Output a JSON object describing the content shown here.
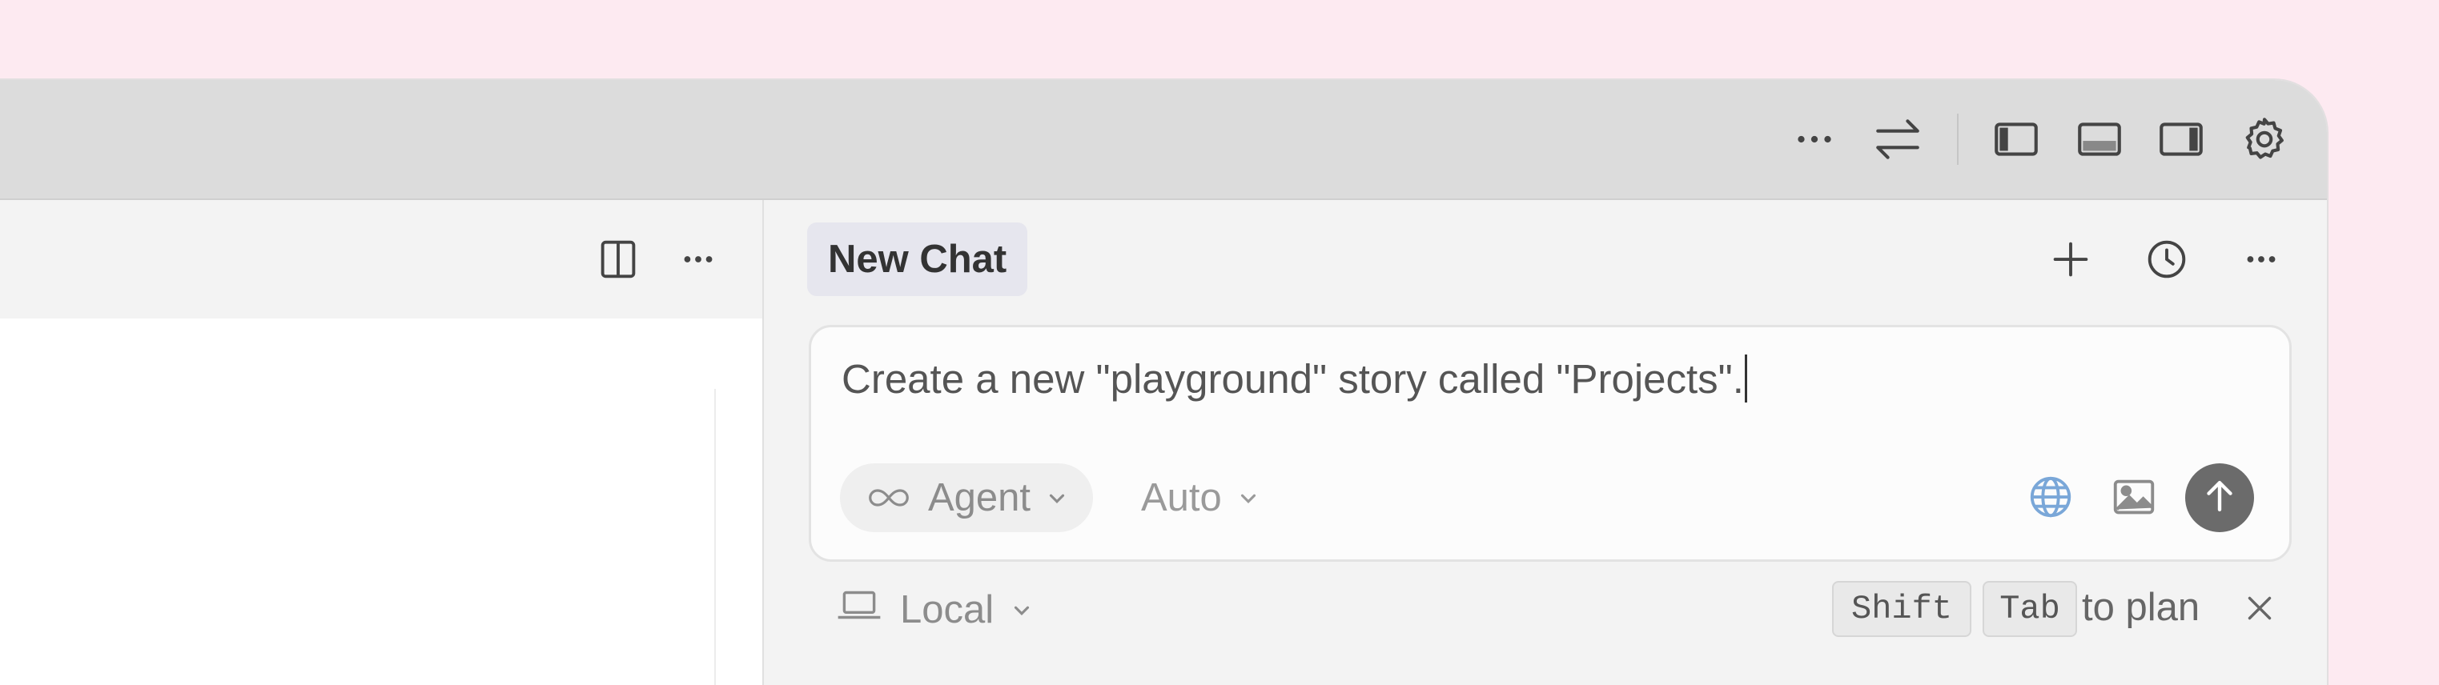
{
  "titlebar": {
    "icons": [
      "more-icon",
      "swap-arrows-icon",
      "toggle-left-panel-icon",
      "toggle-bottom-panel-icon",
      "toggle-right-panel-icon",
      "settings-gear-icon"
    ]
  },
  "editor": {
    "icons": [
      "split-editor-icon",
      "more-icon"
    ]
  },
  "chat": {
    "tab_label": "New Chat",
    "header_icons": [
      "new-chat-plus-icon",
      "history-clock-icon",
      "more-icon"
    ],
    "composer": {
      "prompt_text": "Create a new \"playground\" story called \"Projects\".",
      "mode_label": "Agent",
      "model_label": "Auto"
    },
    "footer": {
      "env_label": "Local",
      "key_shift": "Shift",
      "key_tab": "Tab",
      "hint_text": "to plan"
    }
  },
  "colors": {
    "page_background": "#fdeaf1",
    "titlebar": "#dcdcdc",
    "send_button": "#6b6b6b",
    "globe_icon": "#7aa7d8"
  }
}
